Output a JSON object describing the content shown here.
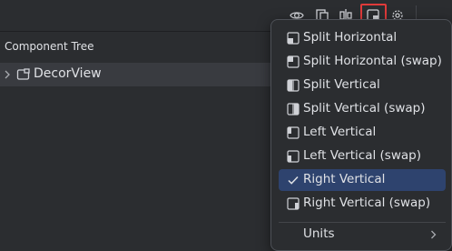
{
  "panel": {
    "title": "Component Tree"
  },
  "tree": {
    "root_label": "DecorView"
  },
  "toolbar": {
    "icons": [
      "eye-icon",
      "copy-layout-icon",
      "align-icon",
      "layout-split-icon",
      "settings-icon"
    ],
    "highlight_color": "#e03a3a"
  },
  "menu": {
    "items": [
      {
        "label": "Split Horizontal",
        "icon": "split-horizontal-icon",
        "selected": false
      },
      {
        "label": "Split Horizontal (swap)",
        "icon": "split-horizontal-swap-icon",
        "selected": false
      },
      {
        "label": "Split Vertical",
        "icon": "split-vertical-icon",
        "selected": false
      },
      {
        "label": "Split Vertical (swap)",
        "icon": "split-vertical-swap-icon",
        "selected": false
      },
      {
        "label": "Left Vertical",
        "icon": "left-vertical-icon",
        "selected": false
      },
      {
        "label": "Left Vertical (swap)",
        "icon": "left-vertical-swap-icon",
        "selected": false
      },
      {
        "label": "Right Vertical",
        "icon": "check-icon",
        "selected": true
      },
      {
        "label": "Right Vertical (swap)",
        "icon": "right-vertical-swap-icon",
        "selected": false
      }
    ],
    "units_label": "Units",
    "selected_color": "#2e436e"
  }
}
